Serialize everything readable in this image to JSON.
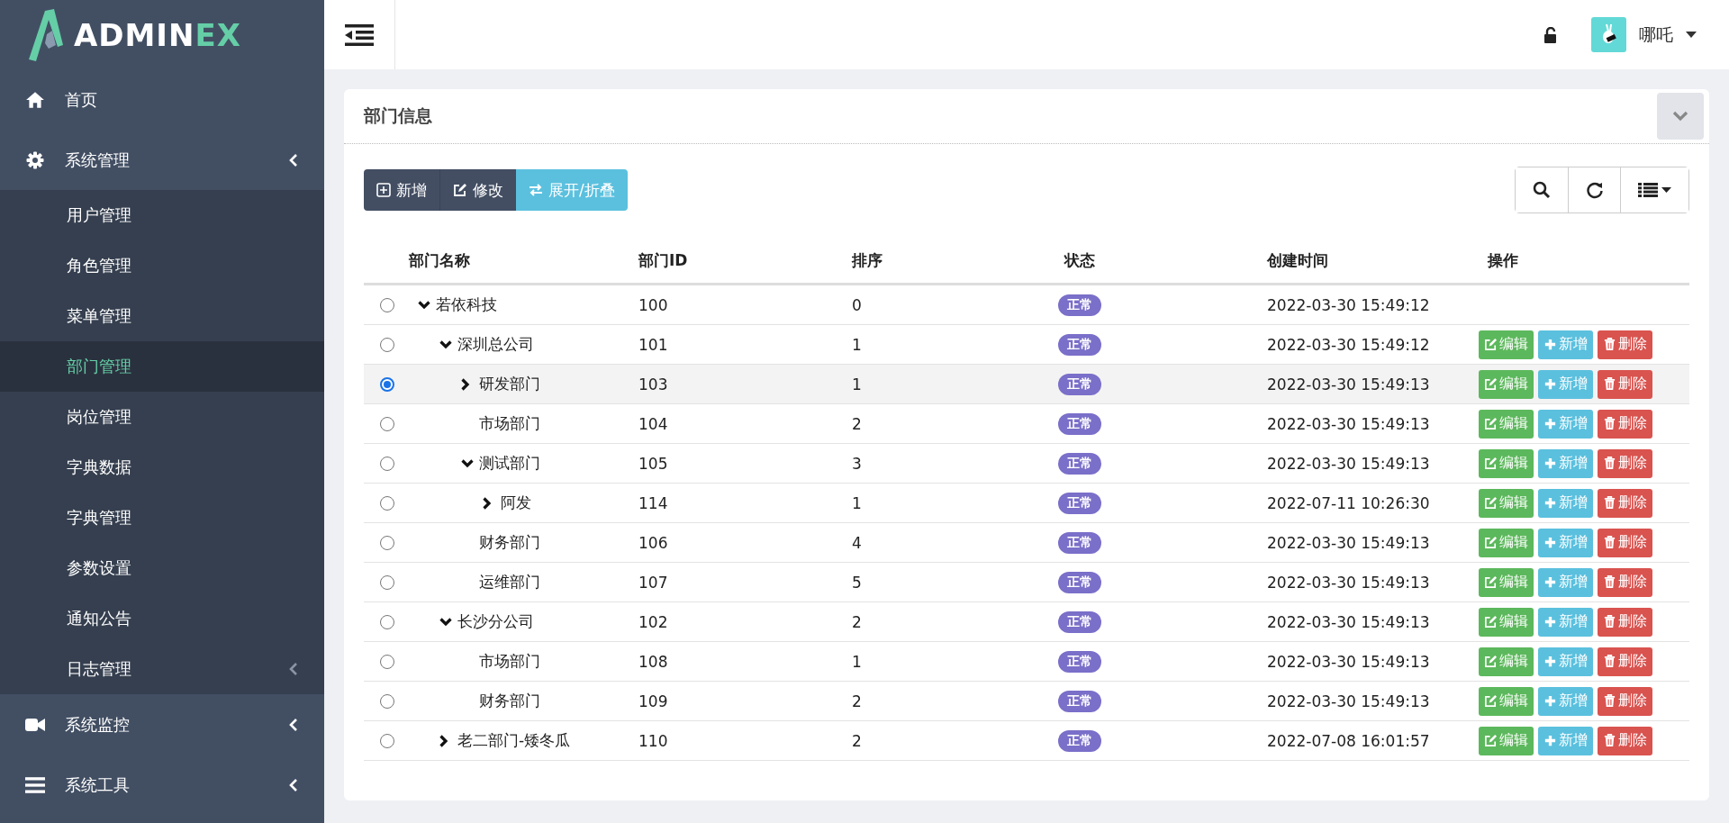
{
  "logo": {
    "text": "ADMIN",
    "accent": "EX"
  },
  "sidebar": {
    "items": [
      {
        "label": "首页",
        "kind": "link"
      },
      {
        "label": "系统管理",
        "kind": "group",
        "children": [
          {
            "label": "用户管理",
            "selected": false
          },
          {
            "label": "角色管理",
            "selected": false
          },
          {
            "label": "菜单管理",
            "selected": false
          },
          {
            "label": "部门管理",
            "selected": true
          },
          {
            "label": "岗位管理",
            "selected": false
          },
          {
            "label": "字典数据",
            "selected": false
          },
          {
            "label": "字典管理",
            "selected": false
          },
          {
            "label": "参数设置",
            "selected": false
          },
          {
            "label": "通知公告",
            "selected": false
          },
          {
            "label": "日志管理",
            "selected": false,
            "kind": "group"
          }
        ]
      },
      {
        "label": "系统监控",
        "kind": "group"
      },
      {
        "label": "系统工具",
        "kind": "group"
      }
    ]
  },
  "header": {
    "user": "哪吒"
  },
  "panel": {
    "title": "部门信息",
    "toolbar": [
      {
        "label": "新增",
        "kind": "add"
      },
      {
        "label": "修改",
        "kind": "edit"
      },
      {
        "label": "展开/折叠",
        "kind": "toggle"
      }
    ],
    "table": {
      "columns": [
        "部门名称",
        "部门ID",
        "排序",
        "状态",
        "创建时间",
        "操作"
      ],
      "rows": [
        {
          "name": "若依科技",
          "id": "100",
          "order": "0",
          "status": "正常",
          "created": "2022-03-30 15:49:12",
          "selected": false,
          "expanded": true,
          "children": [
            {
              "name": "深圳总公司",
              "id": "101",
              "order": "1",
              "status": "正常",
              "created": "2022-03-30 15:49:12",
              "selected": false,
              "expanded": true,
              "actions": [
                {
                  "label": "编辑",
                  "kind": "edit"
                },
                {
                  "label": "新增",
                  "kind": "add"
                },
                {
                  "label": "删除",
                  "kind": "delete"
                }
              ],
              "children": [
                {
                  "name": "研发部门",
                  "id": "103",
                  "order": "1",
                  "status": "正常",
                  "created": "2022-03-30 15:49:13",
                  "selected": true,
                  "expanded": false,
                  "actions": [
                    {
                      "label": "编辑",
                      "kind": "edit"
                    },
                    {
                      "label": "新增",
                      "kind": "add"
                    },
                    {
                      "label": "删除",
                      "kind": "delete"
                    }
                  ]
                },
                {
                  "name": "市场部门",
                  "id": "104",
                  "order": "2",
                  "status": "正常",
                  "created": "2022-03-30 15:49:13",
                  "selected": false,
                  "actions": [
                    {
                      "label": "编辑",
                      "kind": "edit"
                    },
                    {
                      "label": "新增",
                      "kind": "add"
                    },
                    {
                      "label": "删除",
                      "kind": "delete"
                    }
                  ]
                },
                {
                  "name": "测试部门",
                  "id": "105",
                  "order": "3",
                  "status": "正常",
                  "created": "2022-03-30 15:49:13",
                  "selected": false,
                  "expanded": true,
                  "actions": [
                    {
                      "label": "编辑",
                      "kind": "edit"
                    },
                    {
                      "label": "新增",
                      "kind": "add"
                    },
                    {
                      "label": "删除",
                      "kind": "delete"
                    }
                  ],
                  "children": [
                    {
                      "name": "阿发",
                      "id": "114",
                      "order": "1",
                      "status": "正常",
                      "created": "2022-07-11 10:26:30",
                      "selected": false,
                      "expanded": false,
                      "actions": [
                        {
                          "label": "编辑",
                          "kind": "edit"
                        },
                        {
                          "label": "新增",
                          "kind": "add"
                        },
                        {
                          "label": "删除",
                          "kind": "delete"
                        }
                      ]
                    }
                  ]
                },
                {
                  "name": "财务部门",
                  "id": "106",
                  "order": "4",
                  "status": "正常",
                  "created": "2022-03-30 15:49:13",
                  "selected": false,
                  "actions": [
                    {
                      "label": "编辑",
                      "kind": "edit"
                    },
                    {
                      "label": "新增",
                      "kind": "add"
                    },
                    {
                      "label": "删除",
                      "kind": "delete"
                    }
                  ]
                },
                {
                  "name": "运维部门",
                  "id": "107",
                  "order": "5",
                  "status": "正常",
                  "created": "2022-03-30 15:49:13",
                  "selected": false,
                  "actions": [
                    {
                      "label": "编辑",
                      "kind": "edit"
                    },
                    {
                      "label": "新增",
                      "kind": "add"
                    },
                    {
                      "label": "删除",
                      "kind": "delete"
                    }
                  ]
                }
              ]
            },
            {
              "name": "长沙分公司",
              "id": "102",
              "order": "2",
              "status": "正常",
              "created": "2022-03-30 15:49:13",
              "selected": false,
              "expanded": true,
              "actions": [
                {
                  "label": "编辑",
                  "kind": "edit"
                },
                {
                  "label": "新增",
                  "kind": "add"
                },
                {
                  "label": "删除",
                  "kind": "delete"
                }
              ],
              "children": [
                {
                  "name": "市场部门",
                  "id": "108",
                  "order": "1",
                  "status": "正常",
                  "created": "2022-03-30 15:49:13",
                  "selected": false,
                  "actions": [
                    {
                      "label": "编辑",
                      "kind": "edit"
                    },
                    {
                      "label": "新增",
                      "kind": "add"
                    },
                    {
                      "label": "删除",
                      "kind": "delete"
                    }
                  ]
                },
                {
                  "name": "财务部门",
                  "id": "109",
                  "order": "2",
                  "status": "正常",
                  "created": "2022-03-30 15:49:13",
                  "selected": false,
                  "actions": [
                    {
                      "label": "编辑",
                      "kind": "edit"
                    },
                    {
                      "label": "新增",
                      "kind": "add"
                    },
                    {
                      "label": "删除",
                      "kind": "delete"
                    }
                  ]
                }
              ]
            },
            {
              "name": "老二部门-矮冬瓜",
              "id": "110",
              "order": "2",
              "status": "正常",
              "created": "2022-07-08 16:01:57",
              "selected": false,
              "expanded": false,
              "actions": [
                {
                  "label": "编辑",
                  "kind": "edit"
                },
                {
                  "label": "新增",
                  "kind": "add"
                },
                {
                  "label": "删除",
                  "kind": "delete"
                }
              ]
            }
          ]
        }
      ]
    }
  }
}
